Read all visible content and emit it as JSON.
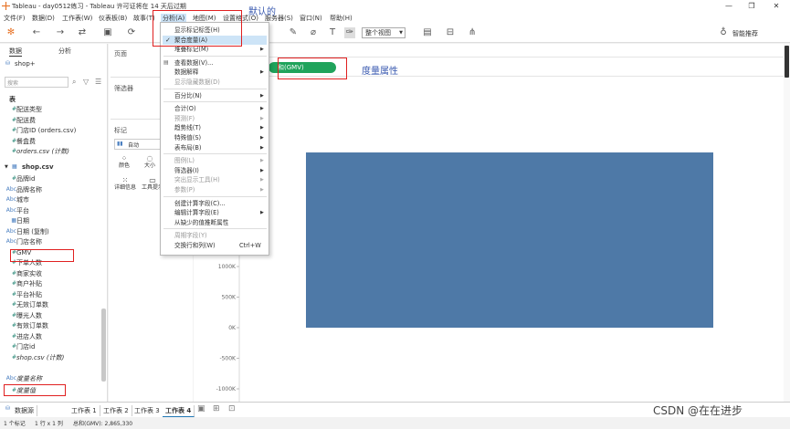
{
  "window": {
    "title": "Tableau - day0512练习 - Tableau 许可证将在 14 天后过期",
    "minimize": "—",
    "maximize": "❐",
    "close": "✕"
  },
  "menubar": [
    "文件(F)",
    "数据(D)",
    "工作表(W)",
    "仪表板(B)",
    "故事(T)",
    "分析(A)",
    "地图(M)",
    "设置格式(O)",
    "服务器(S)",
    "窗口(N)",
    "帮助(H)"
  ],
  "annotation_default": "默认的",
  "annotation_measure": "度量属性",
  "toolbar": {
    "fit_select": "整个视图",
    "smart_recommend": "智能推荐"
  },
  "left_panel": {
    "tab_data": "数据",
    "tab_analysis": "分析",
    "datasource": "shop+",
    "search_placeholder": "搜索",
    "section_table": "表",
    "fields_top": [
      {
        "icon": "#",
        "name": "配送类型"
      },
      {
        "icon": "#",
        "name": "配送费"
      },
      {
        "icon": "#",
        "name": "门店ID (orders.csv)"
      },
      {
        "icon": "#",
        "name": "餐盒费"
      },
      {
        "icon": "#",
        "name": "orders.csv (计数)"
      }
    ],
    "shop_table": "shop.csv",
    "shop_fields": [
      {
        "icon": "#",
        "name": "品牌id"
      },
      {
        "icon": "Abc",
        "name": "品牌名称"
      },
      {
        "icon": "Abc",
        "name": "城市"
      },
      {
        "icon": "Abc",
        "name": "平台"
      },
      {
        "icon": "▦",
        "name": "日期"
      },
      {
        "icon": "Abc",
        "name": "日期 (复制)"
      },
      {
        "icon": "Abc",
        "name": "门店名称"
      },
      {
        "icon": "#",
        "name": "GMV"
      },
      {
        "icon": "#",
        "name": "下单人数"
      },
      {
        "icon": "#",
        "name": "商家实收"
      },
      {
        "icon": "#",
        "name": "商户补贴"
      },
      {
        "icon": "#",
        "name": "平台补贴"
      },
      {
        "icon": "#",
        "name": "无效订单数"
      },
      {
        "icon": "#",
        "name": "曝光人数"
      },
      {
        "icon": "#",
        "name": "有效订单数"
      },
      {
        "icon": "#",
        "name": "进店人数"
      },
      {
        "icon": "#",
        "name": "门店id"
      },
      {
        "icon": "#",
        "name": "shop.csv (计数)"
      }
    ],
    "measure_names": "度量名称",
    "measure_values": "度量值"
  },
  "mid_panel": {
    "pages": "页面",
    "filters": "筛选器",
    "marks": "标记",
    "mark_type": "自动",
    "color": "颜色",
    "size": "大小",
    "detail": "详细信息",
    "tooltip": "工具提示"
  },
  "pill": {
    "text": "和(GMV)"
  },
  "dropdown": {
    "items": [
      {
        "label": "显示标记标签(H)",
        "disabled": false,
        "arrow": false,
        "checked": false
      },
      {
        "label": "聚合度量(A)",
        "disabled": false,
        "arrow": false,
        "checked": true
      },
      {
        "label": "堆叠标记(M)",
        "disabled": false,
        "arrow": true,
        "checked": false
      },
      {
        "label": "查看数据(V)...",
        "disabled": false,
        "arrow": false,
        "checked": false
      },
      {
        "label": "数据解释",
        "disabled": false,
        "arrow": true,
        "checked": false
      },
      {
        "label": "显示隐藏数据(D)",
        "disabled": true,
        "arrow": false,
        "checked": false
      },
      {
        "label": "百分比(N)",
        "disabled": false,
        "arrow": true,
        "checked": false
      },
      {
        "label": "合计(O)",
        "disabled": false,
        "arrow": true,
        "checked": false
      },
      {
        "label": "预测(F)",
        "disabled": true,
        "arrow": true,
        "checked": false
      },
      {
        "label": "趋势线(T)",
        "disabled": false,
        "arrow": true,
        "checked": false
      },
      {
        "label": "特殊值(S)",
        "disabled": false,
        "arrow": true,
        "checked": false
      },
      {
        "label": "表布局(B)",
        "disabled": false,
        "arrow": true,
        "checked": false
      },
      {
        "label": "图例(L)",
        "disabled": true,
        "arrow": true,
        "checked": false
      },
      {
        "label": "筛选器(I)",
        "disabled": false,
        "arrow": true,
        "checked": false
      },
      {
        "label": "突出显示工具(H)",
        "disabled": true,
        "arrow": true,
        "checked": false
      },
      {
        "label": "参数(P)",
        "disabled": true,
        "arrow": true,
        "checked": false
      },
      {
        "label": "创建计算字段(C)...",
        "disabled": false,
        "arrow": false,
        "checked": false
      },
      {
        "label": "编辑计算字段(E)",
        "disabled": false,
        "arrow": true,
        "checked": false
      },
      {
        "label": "从缺少的值推断属性",
        "disabled": false,
        "arrow": false,
        "checked": false
      },
      {
        "label": "周期字段(Y)",
        "disabled": true,
        "arrow": false,
        "checked": false
      },
      {
        "label": "交换行和列(W)",
        "disabled": false,
        "arrow": false,
        "checked": false,
        "shortcut": "Ctrl+W"
      }
    ]
  },
  "chart_data": {
    "type": "bar",
    "categories": [
      ""
    ],
    "values": [
      2865330
    ],
    "ylim": [
      -1000000,
      3000000
    ],
    "yticks": [
      "1000K",
      "500K",
      "0K",
      "-500K",
      "-1000K"
    ],
    "color": "#4e79a7"
  },
  "sheet_tabs": [
    "数据源",
    "工作表 1",
    "工作表 2",
    "工作表 3",
    "工作表 4"
  ],
  "status": {
    "marks": "1 个标记",
    "rowcol": "1 行 x 1 列",
    "sum": "总和(GMV): 2,865,330"
  },
  "watermark": "CSDN @在在进步"
}
